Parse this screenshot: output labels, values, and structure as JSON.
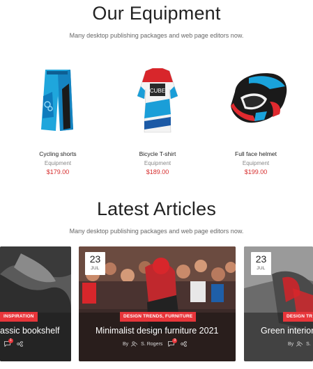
{
  "equipment": {
    "title": "Our Equipment",
    "subtitle": "Many desktop publishing packages and web page editors now.",
    "products": [
      {
        "name": "Cycling shorts",
        "category": "Equipment",
        "price": "$179.00"
      },
      {
        "name": "Bicycle T-shirt",
        "category": "Equipment",
        "price": "$189.00"
      },
      {
        "name": "Full face helmet",
        "category": "Equipment",
        "price": "$199.00"
      }
    ]
  },
  "articles": {
    "title": "Latest Articles",
    "subtitle": "Many desktop publishing packages and web page editors now.",
    "items": [
      {
        "tag": "INSPIRATION",
        "title": "assic bookshelf",
        "comment_count": "1"
      },
      {
        "day": "23",
        "month": "JUL",
        "tag": "DESIGN TRENDS, FURNITURE",
        "title": "Minimalist design furniture 2021",
        "by": "By",
        "author": "S. Rogers",
        "comment_count": "3"
      },
      {
        "day": "23",
        "month": "JUL",
        "tag": "DESIGN TR",
        "title": "Green interior",
        "by": "By",
        "author": "S."
      }
    ]
  },
  "colors": {
    "accent": "#e8353a",
    "price": "#d62d2d"
  }
}
